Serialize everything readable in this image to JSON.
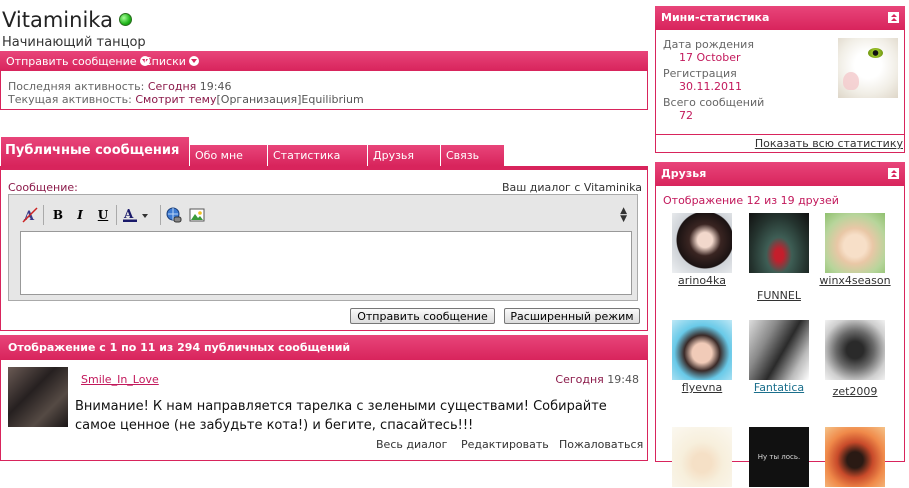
{
  "profile": {
    "username": "Vitaminika",
    "title": "Начинающий танцор",
    "status": "online"
  },
  "actions_bar": {
    "send_message": "Отправить сообщение",
    "lists": "Списки"
  },
  "activity": {
    "last_label": "Последняя активность:",
    "last_value": "Сегодня",
    "last_time": "19:46",
    "current_label": "Текущая активность:",
    "current_value": "Смотрит тему",
    "current_topic": "[Организация]Equilibrium"
  },
  "tabs": [
    {
      "label": "Публичные сообщения",
      "active": true
    },
    {
      "label": "Обо мне"
    },
    {
      "label": "Статистика"
    },
    {
      "label": "Друзья"
    },
    {
      "label": "Связь"
    }
  ],
  "message_form": {
    "label": "Сообщение:",
    "dialog_with": "Ваш диалог с Vitaminika",
    "send_button": "Отправить сообщение",
    "advanced_button": "Расширенный режим",
    "toolbar": [
      "remove-format-icon",
      "bold-icon",
      "italic-icon",
      "underline-icon",
      "text-color-icon",
      "link-icon",
      "image-icon"
    ]
  },
  "public_messages": {
    "header": "Отображение с 1 по 11 из 294 публичных сообщений",
    "posts": [
      {
        "author": "Smile_In_Love",
        "date": "Сегодня",
        "time": "19:48",
        "text": "Внимание! К нам направляется тарелка с зелеными существами! Собирайте самое ценное (не забудьте кота!) и бегите, спасайтесь!!!",
        "actions": [
          "Весь диалог",
          "Редактировать",
          "Пожаловаться"
        ]
      }
    ]
  },
  "mini_stats": {
    "header": "Мини-статистика",
    "birthday_label": "Дата рождения",
    "birthday_value": "17 October",
    "registration_label": "Регистрация",
    "registration_value": "30.11.2011",
    "posts_label": "Всего сообщений",
    "posts_value": "72",
    "show_all": "Показать всю статистику"
  },
  "friends": {
    "header": "Друзья",
    "count_text": "Отображение 12 из 19 друзей",
    "list": [
      {
        "name": "arino4ka"
      },
      {
        "name": "FUNNEL"
      },
      {
        "name": "winx4season"
      },
      {
        "name": "flyevna"
      },
      {
        "name": "Fantatica"
      },
      {
        "name": "zet2009"
      },
      {
        "name": ""
      },
      {
        "name": "",
        "thumb_text": "Ну ты лось."
      },
      {
        "name": ""
      }
    ]
  },
  "colors": {
    "accent": "#d8245c",
    "accent_light": "#e8457a",
    "link_pink": "#c2185b",
    "dark_red_text": "#8b1a4a"
  }
}
